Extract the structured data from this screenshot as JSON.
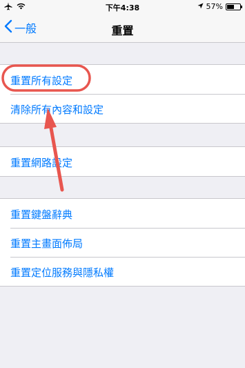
{
  "status_bar": {
    "time": "下午4:38",
    "battery_text": "57%",
    "battery_level": 0.57,
    "icons": [
      "airplane-icon",
      "wifi-icon",
      "location-arrow-icon",
      "battery-icon"
    ]
  },
  "nav": {
    "back_label": "一般",
    "title": "重置"
  },
  "groups": [
    {
      "items": [
        "重置所有設定",
        "清除所有內容和設定"
      ]
    },
    {
      "items": [
        "重置網路設定"
      ]
    },
    {
      "items": [
        "重置鍵盤辭典",
        "重置主畫面佈局",
        "重置定位服務與隱私權"
      ]
    }
  ],
  "colors": {
    "accent": "#007aff",
    "background": "#efeff4",
    "annotation": "#e8564f"
  }
}
